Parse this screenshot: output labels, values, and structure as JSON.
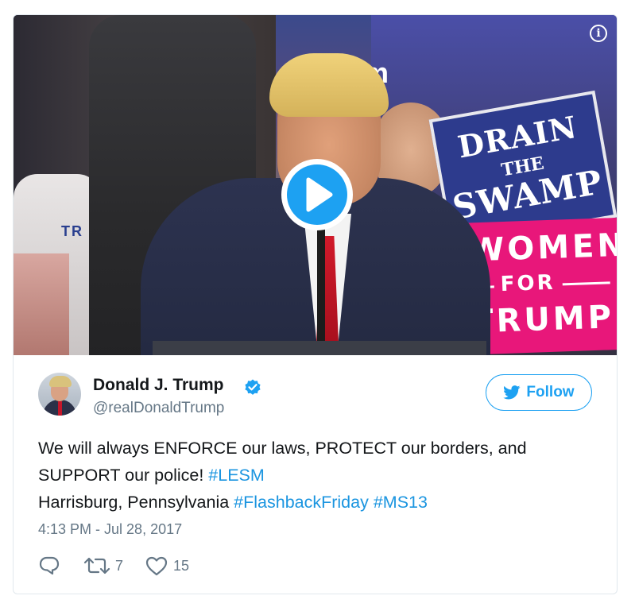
{
  "media": {
    "sign_drain": {
      "line1": "DRAIN",
      "line2": "THE",
      "line3": "SWAMP"
    },
    "sign_women": {
      "line1": "WOMEN",
      "line2": "FOR",
      "line3": "TRUMP"
    },
    "shirt_text": "TR",
    "banner_text": "m",
    "info_icon_glyph": "i",
    "play_icon": "play-icon"
  },
  "author": {
    "name": "Donald J. Trump",
    "handle": "@realDonaldTrump",
    "verified_icon": "verified-badge-icon"
  },
  "follow": {
    "label": "Follow",
    "icon": "twitter-bird-icon"
  },
  "tweet": {
    "segments": [
      {
        "text": "We will always ENFORCE our laws, PROTECT our borders, and SUPPORT our police! ",
        "type": "text"
      },
      {
        "text": "#LESM",
        "type": "hashtag"
      },
      {
        "text": "Harrisburg, Pennsylvania ",
        "type": "text",
        "newline_before": true
      },
      {
        "text": "#FlashbackFriday",
        "type": "hashtag"
      },
      {
        "text": " ",
        "type": "text"
      },
      {
        "text": "#MS13",
        "type": "hashtag"
      }
    ],
    "timestamp": "4:13 PM - Jul 28, 2017"
  },
  "actions": {
    "reply": {
      "icon": "reply-icon",
      "count": ""
    },
    "retweet": {
      "icon": "retweet-icon",
      "count": "7"
    },
    "like": {
      "icon": "heart-icon",
      "count": "15"
    }
  },
  "colors": {
    "accent": "#1da1f2",
    "hashtag": "#1b95e0",
    "muted": "#657786",
    "text": "#14171a",
    "border": "#e1e8ed"
  }
}
